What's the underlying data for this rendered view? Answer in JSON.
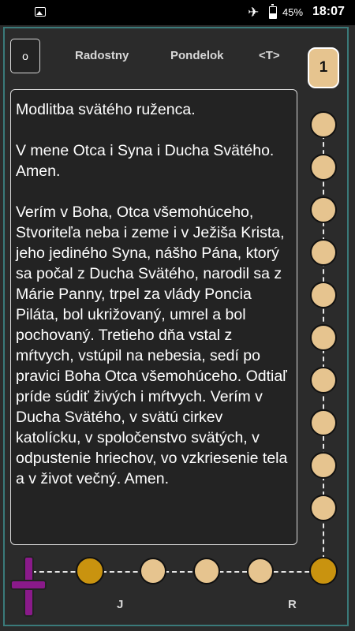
{
  "status": {
    "battery": "45%",
    "time": "18:07",
    "icons": [
      "image-icon",
      "airplane-icon",
      "battery-icon"
    ]
  },
  "header": {
    "button_label": "o",
    "mystery": "Radostny",
    "day": "Pondelok",
    "nav": "<T>",
    "counter": "1"
  },
  "prayer": {
    "paragraphs": [
      "Modlitba svätého ruženca.",
      "V mene Otca i Syna i  Ducha Svätého. Amen.",
      "Verím v Boha, Otca všemohúceho, Stvoriteľa neba i zeme i v Ježiša Krista, jeho jediného Syna, nášho Pána, ktorý sa počal z Ducha Svätého, narodil sa z Márie Panny, trpel za vlády Poncia Piláta, bol ukrižovaný, umrel a bol pochovaný. Tretieho dňa vstal z mŕtvych, vstúpil na nebesia, sedí po pravici Boha Otca všemohúceho. Odtiaľ príde súdiť živých i mŕtvych. Verím v Ducha Svätého, v svätú cirkev katolícku, v spoločenstvo svätých, v odpustenie hriechov, vo vzkriesenie tela a v život večný. Amen."
    ]
  },
  "rosary": {
    "labels": {
      "left": "J",
      "right": "R"
    },
    "colors": {
      "hail_bead": "#e6c48f",
      "our_father_bead": "#c9930f",
      "cross": "#8a1a8a",
      "frame": "#3a7a7a"
    }
  }
}
